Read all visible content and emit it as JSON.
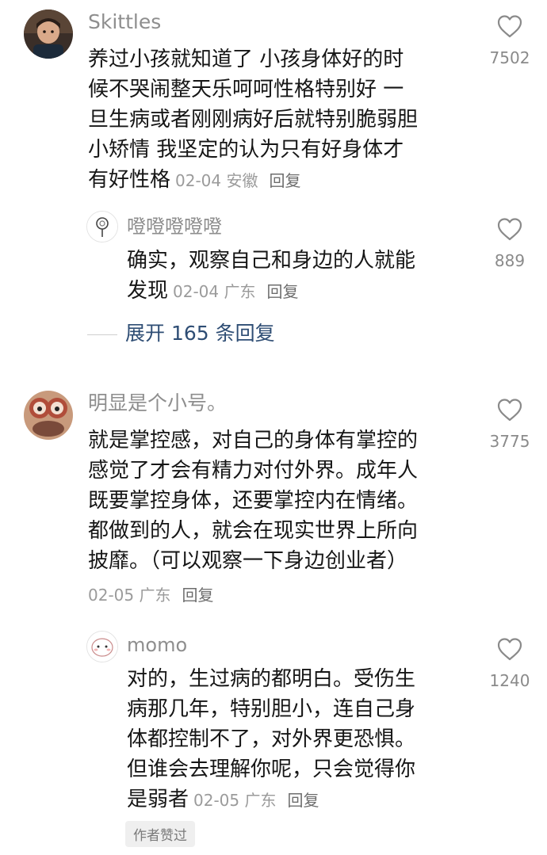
{
  "comments": [
    {
      "username": "Skittles",
      "lines": [
        "养过小孩就知道了 小孩身体好的时",
        "候不哭闹整天乐呵呵性格特别好 一",
        "旦生病或者刚刚病好后就特别脆弱胆",
        "小矫情 我坚定的认为只有好身体才",
        "有好性格"
      ],
      "meta": "02-04 安徽",
      "reply_label": "回复",
      "likes": "7502",
      "avatar_icon": "child-photo-avatar"
    },
    {
      "username": "噔噔噔噔噔",
      "lines": [
        "确实，观察自己和身边的人就能",
        "发现"
      ],
      "meta": "02-04 广东",
      "reply_label": "回复",
      "likes": "889",
      "avatar_icon": "lollipop-avatar"
    },
    {
      "username": "明显是个小号。",
      "lines": [
        "就是掌控感，对自己的身体有掌控的",
        "感觉了才会有精力对付外界。成年人",
        "既要掌控身体，还要掌控内在情绪。",
        "都做到的人，就会在现实世界上所向",
        "披靡。（可以观察一下身边创业者）"
      ],
      "meta": "02-05 广东",
      "reply_label": "回复",
      "likes": "3775",
      "avatar_icon": "cartoon-avatar"
    },
    {
      "username": "momo",
      "lines": [
        "对的，生过病的都明白。受伤生",
        "病那几年，特别胆小，连自己身",
        "体都控制不了，对外界更恐惧。",
        "但谁会去理解你呢，只会觉得你",
        "是弱者"
      ],
      "meta": "02-05 广东",
      "reply_label": "回复",
      "likes": "1240",
      "badge": "作者赞过",
      "avatar_icon": "cute-face-avatar"
    }
  ],
  "expand_replies": "展开 165 条回复",
  "icons": {
    "like": "heart-outline-icon"
  },
  "colors": {
    "link": "#2e4d74",
    "meta": "#9b9b9b",
    "text": "#161616"
  }
}
